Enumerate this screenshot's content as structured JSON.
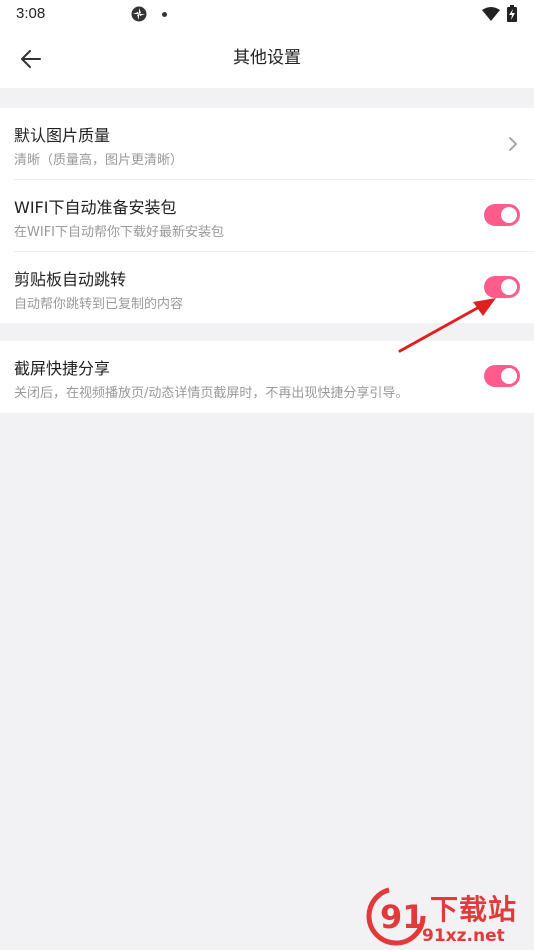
{
  "status_bar": {
    "time": "3:08",
    "icons": [
      "app-notification-icon",
      "dot-icon",
      "wifi-icon",
      "battery-charging-icon"
    ]
  },
  "header": {
    "title": "其他设置",
    "back_icon": "arrow-left-icon"
  },
  "settings": [
    {
      "title": "默认图片质量",
      "subtitle": "清晰（质量高，图片更清晰）",
      "control": "chevron"
    },
    {
      "title": "WIFI下自动准备安装包",
      "subtitle": "在WIFI下自动帮你下载好最新安装包",
      "control": "toggle",
      "on": true
    },
    {
      "title": "剪贴板自动跳转",
      "subtitle": "自动帮你跳转到已复制的内容",
      "control": "toggle",
      "on": true
    },
    {
      "title": "截屏快捷分享",
      "subtitle": "关闭后，在视频播放页/动态详情页截屏时，不再出现快捷分享引导。",
      "control": "toggle",
      "on": true
    }
  ],
  "annotation": {
    "arrow_color": "#e02020",
    "points_to": "剪贴板自动跳转 toggle"
  },
  "watermark": {
    "brand_text": "下载站",
    "url_text": "91xz.net",
    "logo_text": "91"
  },
  "colors": {
    "accent": "#ff5b8d",
    "background": "#f2f2f4",
    "card": "#ffffff",
    "subtitle": "#9a9a9a"
  }
}
